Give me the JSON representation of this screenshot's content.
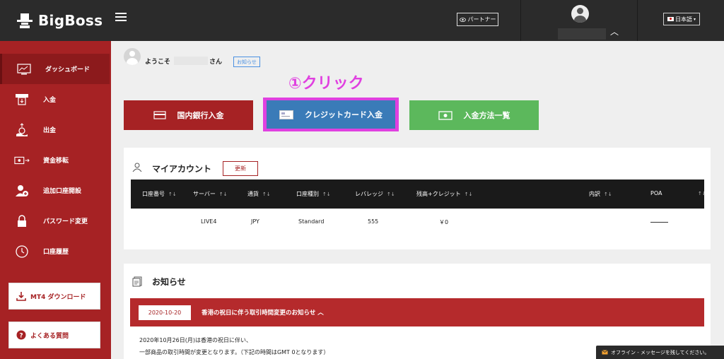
{
  "header": {
    "brand": "BigBoss",
    "partner_label": "パートナー",
    "language_label": "日本語"
  },
  "sidebar": {
    "items": [
      {
        "label": "ダッシュボード",
        "icon": "dashboard-icon"
      },
      {
        "label": "入金",
        "icon": "deposit-icon"
      },
      {
        "label": "出金",
        "icon": "withdraw-icon"
      },
      {
        "label": "資金移転",
        "icon": "transfer-icon"
      },
      {
        "label": "追加口座開設",
        "icon": "add-account-icon"
      },
      {
        "label": "パスワード変更",
        "icon": "lock-icon"
      },
      {
        "label": "口座履歴",
        "icon": "history-icon"
      }
    ],
    "mt4_download_label": "MT4 ダウンロード",
    "faq_label": "よくある質問"
  },
  "welcome": {
    "prefix": "ようこそ",
    "suffix": "さん",
    "news_tag": "お知らせ"
  },
  "annotation": "①クリック",
  "actions": {
    "bank_label": "国内銀行入金",
    "card_label": "クレジットカード入金",
    "methods_label": "入金方法一覧"
  },
  "account": {
    "title": "マイアカウント",
    "refresh_label": "更新",
    "columns": [
      "口座番号",
      "サーバー",
      "通貨",
      "口座種別",
      "レバレッジ",
      "残高+クレジット",
      "内訳",
      "POA"
    ],
    "row": {
      "account_no": "",
      "server": "LIVE4",
      "currency": "JPY",
      "type": "Standard",
      "leverage": "555",
      "balance": "￥0"
    }
  },
  "news": {
    "title": "お知らせ",
    "date": "2020-10-20",
    "headline": "香港の祝日に伴う取引時間変更のお知らせ ︿",
    "body_line1": "2020年10月26日(月)は香港の祝日に伴い、",
    "body_line2": "一部商品の取引時間が変更となります。（下記の時間はGMT 0となります）"
  },
  "chat": {
    "offline_label": "オフライン - メッセージを残してください。"
  },
  "colors": {
    "brand_red": "#a62224",
    "card_blue": "#3a7bb8",
    "methods_green": "#5cb85c",
    "annotation_magenta": "#e040e0",
    "topbar": "#2b2b2b"
  }
}
